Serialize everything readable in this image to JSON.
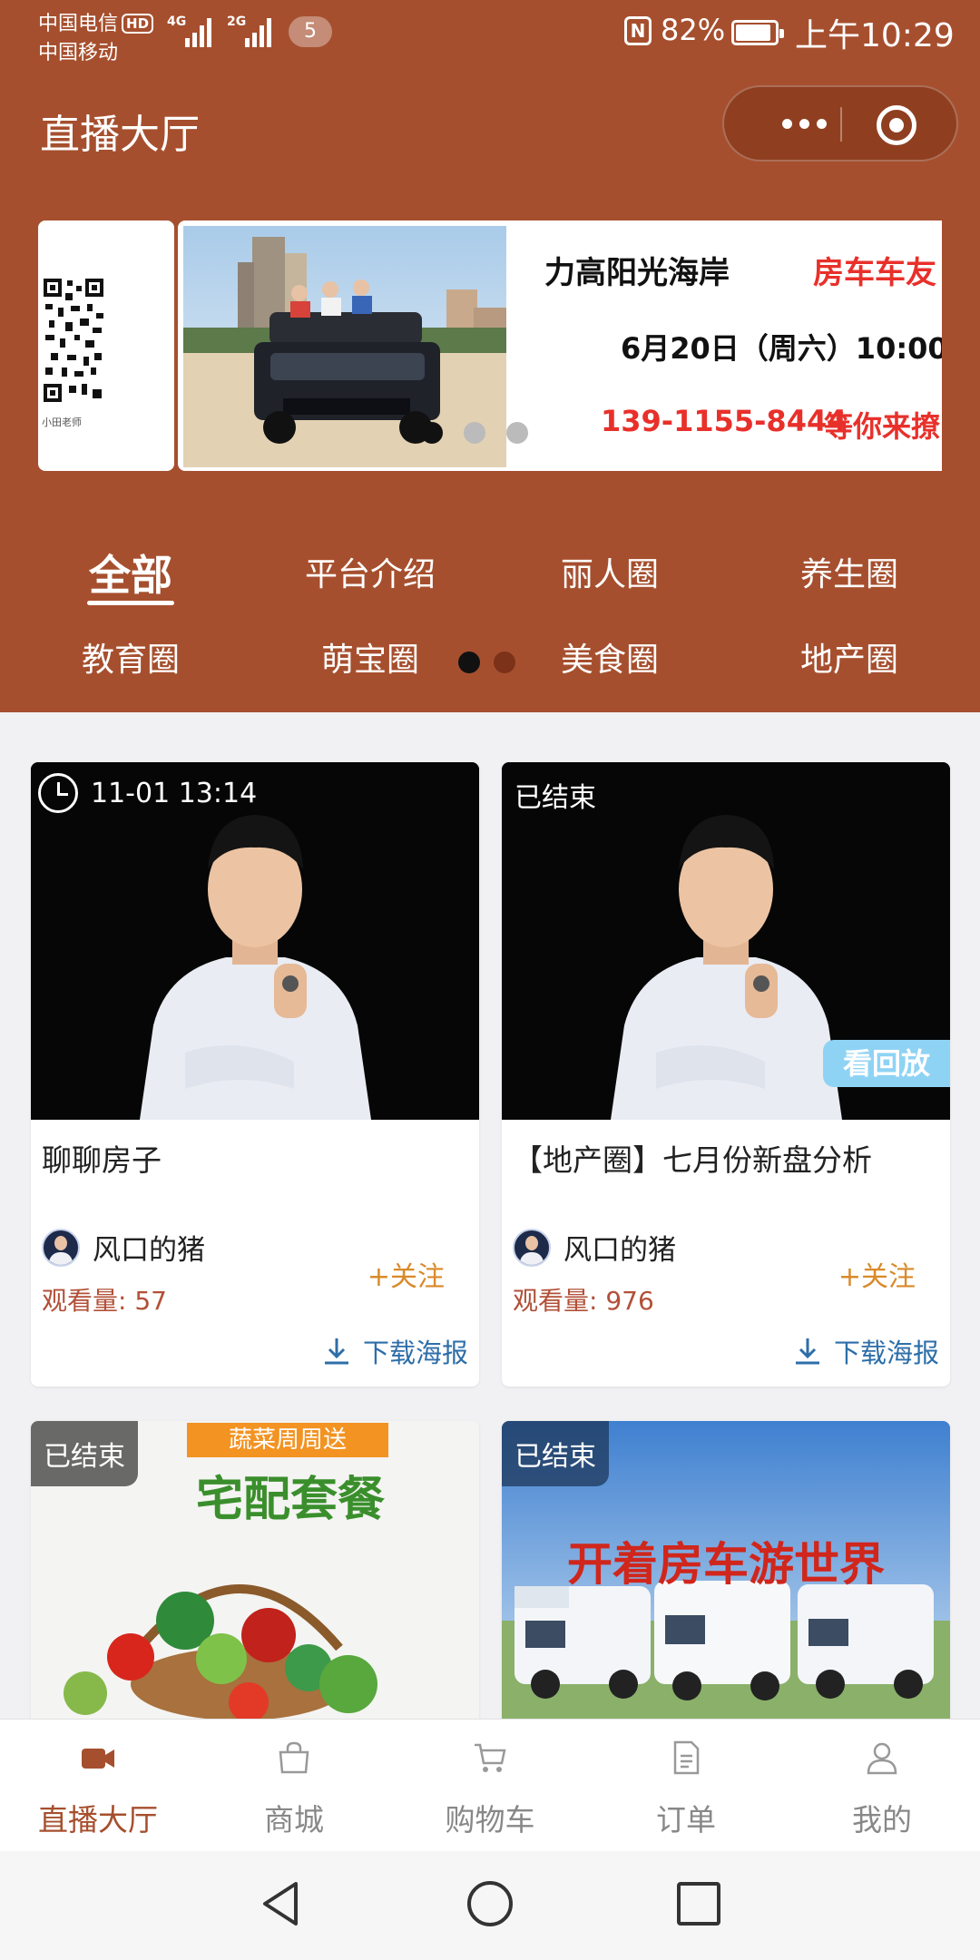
{
  "status_bar": {
    "carrier1": "中国电信",
    "hd": "HD",
    "carrier2": "中国移动",
    "signal1_label": "4G",
    "signal2_label": "2G",
    "notification_count": "5",
    "nfc": "N",
    "battery": "82%",
    "battery_level": 0.82,
    "time": "上午10:29"
  },
  "nav": {
    "title": "直播大厅"
  },
  "banner": {
    "line1": "力高阳光海岸",
    "line1_right": "房车车友",
    "line2": "6月20日（周六）10:00",
    "line3": "139-1155-8444",
    "line3_right": "等你来撩",
    "qr_caption": "小田老师",
    "page_count": 3,
    "active_index": 0
  },
  "categories": {
    "row1": [
      "全部",
      "平台介绍",
      "丽人圈",
      "养生圈"
    ],
    "row2": [
      "教育圈",
      "萌宝圈",
      "美食圈",
      "地产圈"
    ],
    "active": "全部"
  },
  "cards": [
    {
      "time": "11-01 13:14",
      "title": "聊聊房子",
      "author": "风口的猪",
      "follow": "+关注",
      "views": "观看量: 57",
      "download": "下载海报"
    },
    {
      "status": "已结束",
      "replay": "看回放",
      "title": "【地产圈】七月份新盘分析",
      "author": "风口的猪",
      "follow": "+关注",
      "views": "观看量: 976",
      "download": "下载海报"
    },
    {
      "status": "已结束",
      "poster_top": "蔬菜周周送",
      "poster_main": "宅配套餐"
    },
    {
      "status": "已结束",
      "poster_main": "开着房车游世界"
    }
  ],
  "tabbar": [
    {
      "label": "直播大厅",
      "icon": "video-camera-icon",
      "active": true
    },
    {
      "label": "商城",
      "icon": "shopping-bag-icon",
      "active": false
    },
    {
      "label": "购物车",
      "icon": "cart-icon",
      "active": false
    },
    {
      "label": "订单",
      "icon": "document-icon",
      "active": false
    },
    {
      "label": "我的",
      "icon": "user-icon",
      "active": false
    }
  ],
  "colors": {
    "brand": "#a64f2e",
    "follow": "#d98a29",
    "views": "#b25038",
    "download": "#2d6ea8",
    "replay": "#8fd3f4"
  }
}
